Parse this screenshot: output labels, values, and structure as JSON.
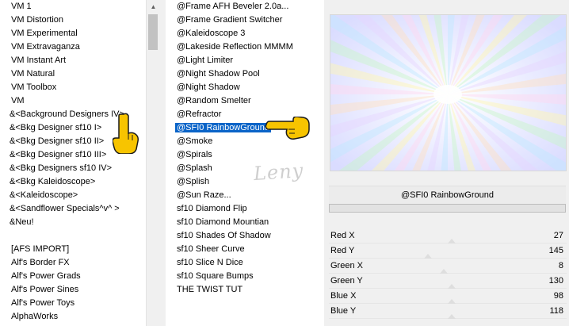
{
  "categories": [
    "VM 1",
    "VM Distortion",
    "VM Experimental",
    "VM Extravaganza",
    "VM Instant Art",
    "VM Natural",
    "VM Toolbox",
    "VM",
    "&<Background Designers IV>",
    "&<Bkg Designer sf10 I>",
    "&<Bkg Designer sf10 II>",
    "&<Bkg Designer sf10 III>",
    "&<Bkg Designers sf10 IV>",
    "&<Bkg Kaleidoscope>",
    "&<Kaleidoscope>",
    "&<Sandflower Specials^v^ >",
    "&Neu!",
    "",
    "[AFS IMPORT]",
    "Alf's Border FX",
    "Alf's Power Grads",
    "Alf's Power Sines",
    "Alf's Power Toys",
    "AlphaWorks"
  ],
  "filters": [
    "@Frame AFH Beveler 2.0a...",
    "@Frame Gradient Switcher",
    "@Kaleidoscope 3",
    "@Lakeside Reflection MMMM",
    "@Light Limiter",
    "@Night Shadow Pool",
    "@Night Shadow",
    "@Random Smelter",
    "@Refractor",
    "@SFI0 RainbowGround",
    "@Smoke",
    "@Spirals",
    "@Splash",
    "@Splish",
    "@Sun Raze...",
    "sf10 Diamond Flip",
    "sf10 Diamond Mountian",
    "sf10 Shades Of Shadow",
    "sf10 Sheer Curve",
    "sf10 Slice N Dice",
    "sf10 Square Bumps",
    "THE TWIST TUT"
  ],
  "selected_filter_index": 9,
  "highlighted_category_index": 8,
  "filter_title": "@SFI0 RainbowGround",
  "watermark": "Leny",
  "params": [
    {
      "name": "Red X",
      "value": "27"
    },
    {
      "name": "Red Y",
      "value": "145"
    },
    {
      "name": "Green X",
      "value": "8"
    },
    {
      "name": "Green Y",
      "value": "130"
    },
    {
      "name": "Blue X",
      "value": "98"
    },
    {
      "name": "Blue Y",
      "value": "118"
    }
  ],
  "colors": {
    "selection": "#0a64c8",
    "hand": "#f7c400"
  }
}
